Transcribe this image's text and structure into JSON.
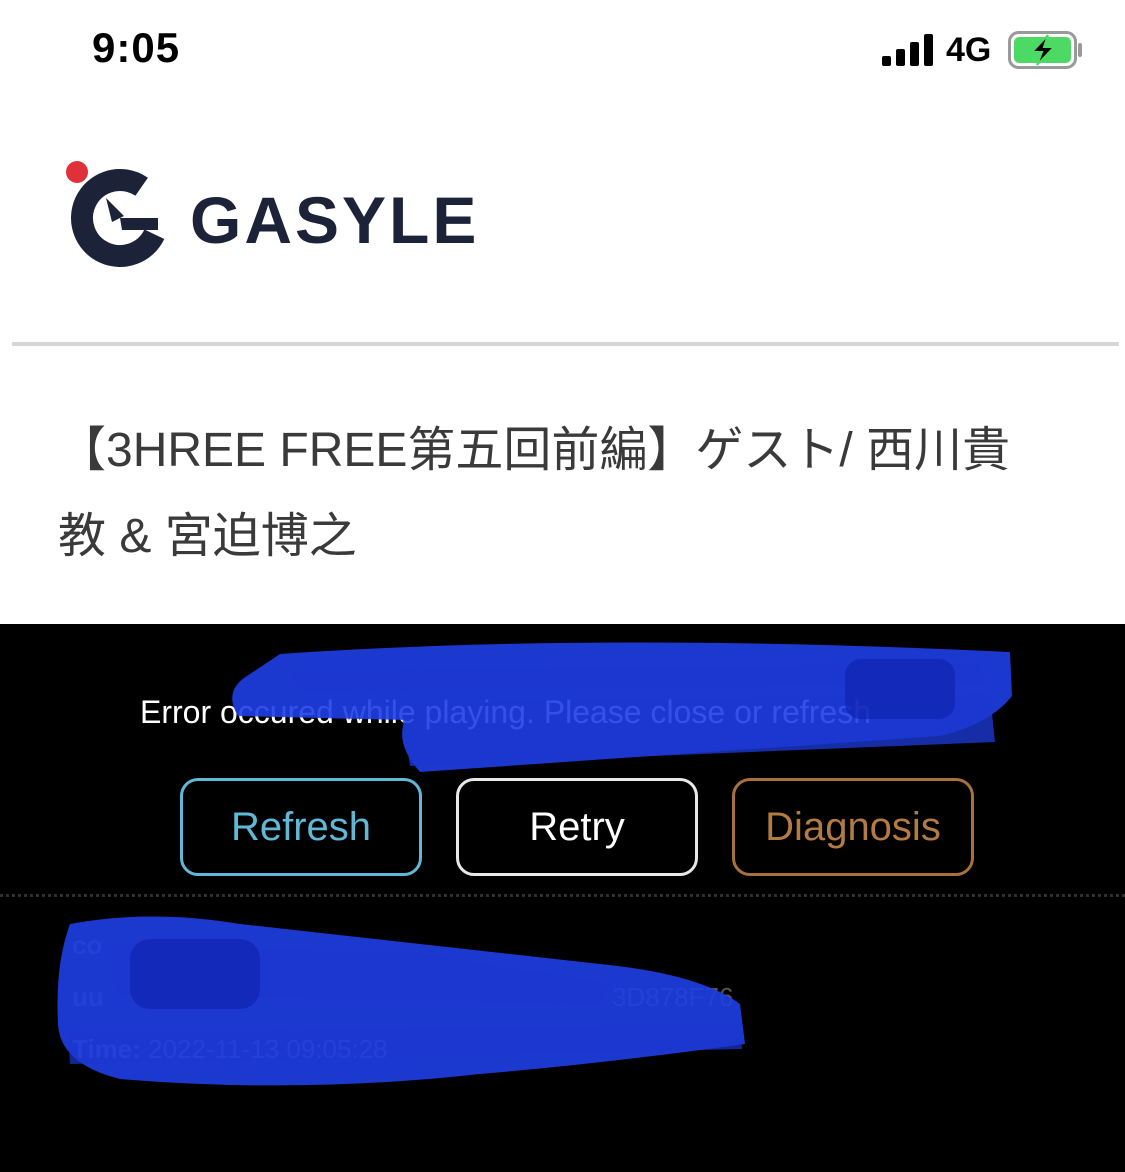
{
  "status_bar": {
    "time": "9:05",
    "network": "4G",
    "signal_icon": "cellular-signal-icon",
    "battery_icon": "battery-charging-icon",
    "battery_color": "#4cd964"
  },
  "header": {
    "brand": "GASYLE",
    "logo_icon": "gasyle-logo-icon",
    "logo_dot_color": "#e0313b",
    "logo_color": "#1c2338"
  },
  "video": {
    "title": "【3HREE FREE第五回前編】ゲスト/ 西川貴教 & 宮迫博之"
  },
  "player": {
    "error_message": "Error occured while playing.   Please close or refresh",
    "buttons": {
      "refresh": "Refresh",
      "retry": "Retry",
      "diagnosis": "Diagnosis"
    },
    "info": {
      "code_key": "co",
      "uuid_key": "uu",
      "uuid_tail": "3D878F76",
      "time_key": "Time:",
      "time_value": "2022-11-13 09:05:28"
    },
    "redaction_color": "#1e3fe6"
  }
}
